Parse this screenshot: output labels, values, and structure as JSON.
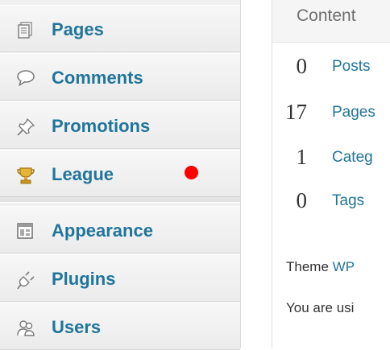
{
  "sidebar": {
    "items": [
      {
        "label": "Pages",
        "icon": "pages-icon"
      },
      {
        "label": "Comments",
        "icon": "comments-icon"
      },
      {
        "label": "Promotions",
        "icon": "pushpin-icon"
      },
      {
        "label": "League",
        "icon": "trophy-icon"
      },
      {
        "label": "Appearance",
        "icon": "appearance-icon"
      },
      {
        "label": "Plugins",
        "icon": "plug-icon"
      },
      {
        "label": "Users",
        "icon": "users-icon"
      }
    ],
    "notification_color": "#ff0000"
  },
  "content": {
    "title": "Content",
    "stats": [
      {
        "count": "0",
        "label": "Posts"
      },
      {
        "count": "17",
        "label": "Pages"
      },
      {
        "count": "1",
        "label": "Categ"
      },
      {
        "count": "0",
        "label": "Tags"
      }
    ],
    "theme_prefix": "Theme",
    "theme_link": "WP",
    "using_text": "You are usi"
  },
  "colors": {
    "link": "#21759b",
    "notification": "#ff0000"
  }
}
